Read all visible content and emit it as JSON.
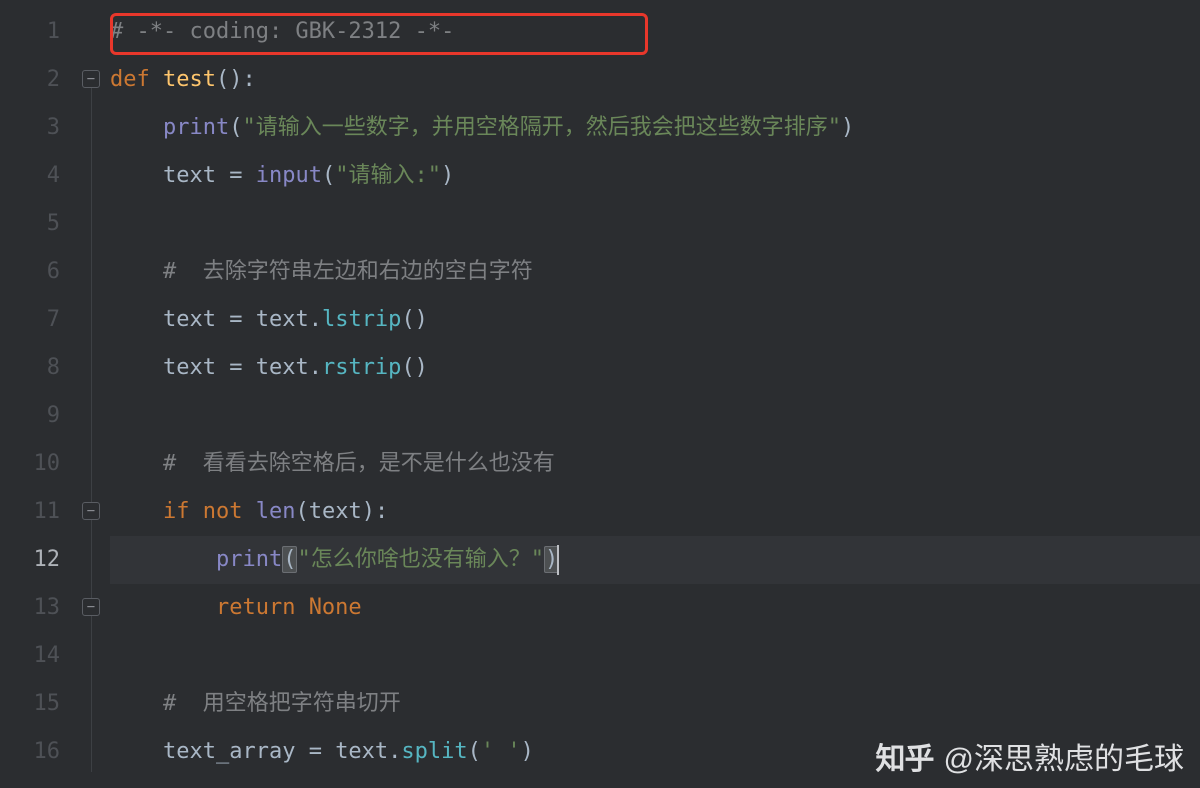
{
  "gutter": {
    "numbers": [
      "1",
      "2",
      "3",
      "4",
      "5",
      "6",
      "7",
      "8",
      "9",
      "10",
      "11",
      "12",
      "13",
      "14",
      "15",
      "16"
    ],
    "current_index": 11
  },
  "code": {
    "lines": [
      {
        "indent": "",
        "tokens": [
          {
            "t": "# -*- coding: GBK-2312 -*-",
            "c": "comment"
          }
        ],
        "highlight": true
      },
      {
        "indent": "",
        "tokens": [
          {
            "t": "def ",
            "c": "keyword"
          },
          {
            "t": "test",
            "c": "def"
          },
          {
            "t": "()",
            "c": "paren"
          },
          {
            "t": ":",
            "c": "text"
          }
        ]
      },
      {
        "indent": "    ",
        "tokens": [
          {
            "t": "print",
            "c": "builtin"
          },
          {
            "t": "(",
            "c": "paren"
          },
          {
            "t": "\"请输入一些数字，并用空格隔开，然后我会把这些数字排序\"",
            "c": "string"
          },
          {
            "t": ")",
            "c": "paren"
          }
        ]
      },
      {
        "indent": "    ",
        "tokens": [
          {
            "t": "text ",
            "c": "text"
          },
          {
            "t": "= ",
            "c": "op"
          },
          {
            "t": "input",
            "c": "builtin"
          },
          {
            "t": "(",
            "c": "paren"
          },
          {
            "t": "\"请输入:\"",
            "c": "string"
          },
          {
            "t": ")",
            "c": "paren"
          }
        ]
      },
      {
        "indent": "",
        "tokens": []
      },
      {
        "indent": "    ",
        "tokens": [
          {
            "t": "#  去除字符串左边和右边的空白字符",
            "c": "comment"
          }
        ]
      },
      {
        "indent": "    ",
        "tokens": [
          {
            "t": "text ",
            "c": "text"
          },
          {
            "t": "= ",
            "c": "op"
          },
          {
            "t": "text",
            "c": "text"
          },
          {
            "t": ".",
            "c": "text"
          },
          {
            "t": "lstrip",
            "c": "func"
          },
          {
            "t": "()",
            "c": "paren"
          }
        ]
      },
      {
        "indent": "    ",
        "tokens": [
          {
            "t": "text ",
            "c": "text"
          },
          {
            "t": "= ",
            "c": "op"
          },
          {
            "t": "text",
            "c": "text"
          },
          {
            "t": ".",
            "c": "text"
          },
          {
            "t": "rstrip",
            "c": "func"
          },
          {
            "t": "()",
            "c": "paren"
          }
        ]
      },
      {
        "indent": "",
        "tokens": []
      },
      {
        "indent": "    ",
        "tokens": [
          {
            "t": "#  看看去除空格后，是不是什么也没有",
            "c": "comment"
          }
        ]
      },
      {
        "indent": "    ",
        "tokens": [
          {
            "t": "if ",
            "c": "keyword"
          },
          {
            "t": "not ",
            "c": "keyword"
          },
          {
            "t": "len",
            "c": "builtin"
          },
          {
            "t": "(",
            "c": "paren"
          },
          {
            "t": "text",
            "c": "text"
          },
          {
            "t": ")",
            "c": "paren"
          },
          {
            "t": ":",
            "c": "text"
          }
        ]
      },
      {
        "indent": "        ",
        "tokens": [
          {
            "t": "print",
            "c": "builtin"
          },
          {
            "t": "(",
            "c": "paren",
            "m": true
          },
          {
            "t": "\"怎么你啥也没有输入？\"",
            "c": "string"
          },
          {
            "t": ")",
            "c": "paren",
            "m": true
          }
        ],
        "cursor": true
      },
      {
        "indent": "        ",
        "tokens": [
          {
            "t": "return ",
            "c": "keyword"
          },
          {
            "t": "None",
            "c": "keyword"
          }
        ]
      },
      {
        "indent": "",
        "tokens": []
      },
      {
        "indent": "    ",
        "tokens": [
          {
            "t": "#  用空格把字符串切开",
            "c": "comment"
          }
        ]
      },
      {
        "indent": "    ",
        "tokens": [
          {
            "t": "text_array ",
            "c": "text"
          },
          {
            "t": "= ",
            "c": "op"
          },
          {
            "t": "text",
            "c": "text"
          },
          {
            "t": ".",
            "c": "text"
          },
          {
            "t": "split",
            "c": "func"
          },
          {
            "t": "(",
            "c": "paren"
          },
          {
            "t": "' '",
            "c": "string"
          },
          {
            "t": ")",
            "c": "paren"
          }
        ]
      }
    ]
  },
  "fold_markers": [
    {
      "line": 2
    },
    {
      "line": 11
    },
    {
      "line": 13,
      "type": "end"
    }
  ],
  "watermark": {
    "logo": "知乎",
    "author": "@深思熟虑的毛球"
  }
}
